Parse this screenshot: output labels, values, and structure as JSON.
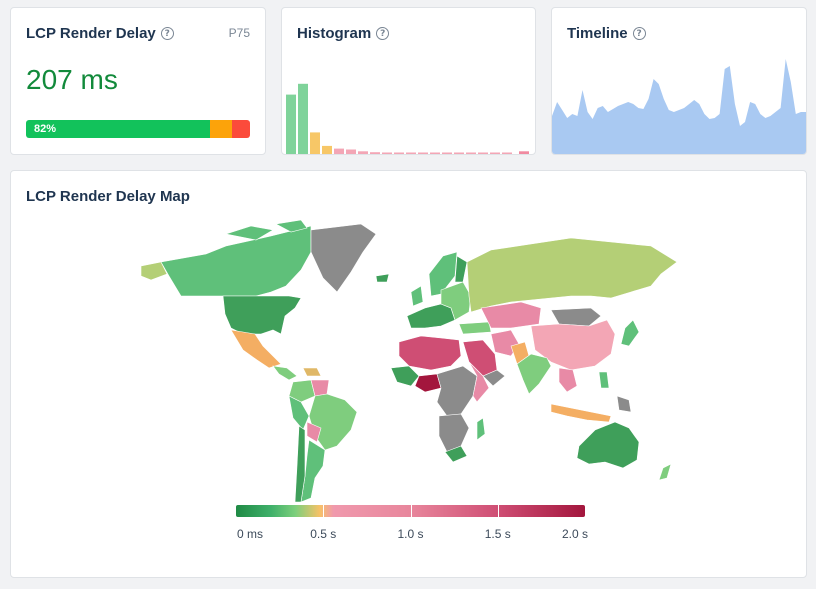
{
  "summary": {
    "title": "LCP Render Delay",
    "percentile": "P75",
    "value": "207 ms",
    "good_label": "82%",
    "distribution": [
      {
        "name": "good",
        "percent": 82,
        "color": "#12c25b"
      },
      {
        "name": "needs-improvement",
        "percent": 10,
        "color": "#fca30a"
      },
      {
        "name": "poor",
        "percent": 8,
        "color": "#fb4b3b"
      }
    ]
  },
  "histogram": {
    "title": "Histogram",
    "bars": [
      {
        "value": 0.66,
        "color": "#7fd39a"
      },
      {
        "value": 0.78,
        "color": "#7fd39a"
      },
      {
        "value": 0.24,
        "color": "#f7c767"
      },
      {
        "value": 0.09,
        "color": "#f7c767"
      },
      {
        "value": 0.06,
        "color": "#f3a6b5"
      },
      {
        "value": 0.05,
        "color": "#f3a6b5"
      },
      {
        "value": 0.03,
        "color": "#f3a6b5"
      },
      {
        "value": 0.02,
        "color": "#f3a6b5"
      },
      {
        "value": 0.01,
        "color": "#f3a6b5"
      },
      {
        "value": 0.01,
        "color": "#f3a6b5"
      },
      {
        "value": 0.01,
        "color": "#f3a6b5"
      },
      {
        "value": 0.01,
        "color": "#f3a6b5"
      },
      {
        "value": 0.01,
        "color": "#f3a6b5"
      },
      {
        "value": 0.01,
        "color": "#f3a6b5"
      },
      {
        "value": 0.01,
        "color": "#f3a6b5"
      },
      {
        "value": 0.01,
        "color": "#f3a6b5"
      },
      {
        "value": 0.01,
        "color": "#f3a6b5"
      },
      {
        "value": 0.01,
        "color": "#f3a6b5"
      },
      {
        "value": 0.01,
        "color": "#f3a6b5"
      },
      {
        "value": 0.03,
        "color": "#f08aa0"
      }
    ]
  },
  "timeline": {
    "title": "Timeline",
    "color": "#a9c9f2",
    "values": [
      0.38,
      0.52,
      0.44,
      0.36,
      0.4,
      0.38,
      0.64,
      0.42,
      0.35,
      0.46,
      0.48,
      0.42,
      0.45,
      0.48,
      0.5,
      0.52,
      0.5,
      0.46,
      0.45,
      0.55,
      0.75,
      0.7,
      0.55,
      0.44,
      0.42,
      0.44,
      0.46,
      0.5,
      0.54,
      0.5,
      0.4,
      0.35,
      0.36,
      0.4,
      0.85,
      0.88,
      0.5,
      0.28,
      0.32,
      0.52,
      0.5,
      0.4,
      0.36,
      0.38,
      0.42,
      0.46,
      0.95,
      0.72,
      0.4,
      0.42,
      0.42
    ]
  },
  "map": {
    "title": "LCP Render Delay Map",
    "legend": {
      "labels": [
        "0 ms",
        "0.5 s",
        "1.0 s",
        "1.5 s",
        "2.0 s"
      ],
      "stops": [
        0,
        0.5,
        1.0,
        1.5,
        2.0
      ],
      "max": 2.0
    }
  }
}
